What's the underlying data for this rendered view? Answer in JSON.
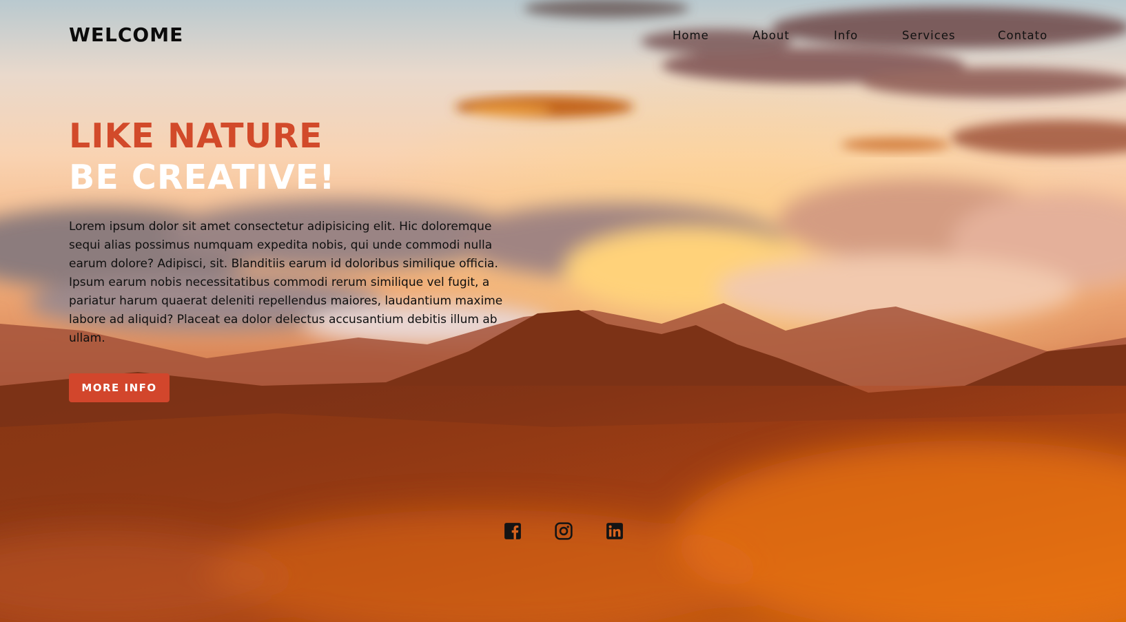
{
  "header": {
    "logo": "WELCOME",
    "nav": [
      {
        "label": "Home"
      },
      {
        "label": "About"
      },
      {
        "label": "Info"
      },
      {
        "label": "Services"
      },
      {
        "label": "Contato"
      }
    ]
  },
  "hero": {
    "title_line1": "LIKE NATURE",
    "title_line2": "BE CREATIVE!",
    "paragraph": "Lorem ipsum dolor sit amet consectetur adipisicing elit. Hic doloremque sequi alias possimus numquam expedita nobis, qui unde commodi nulla earum dolore? Adipisci, sit. Blanditiis earum id doloribus similique officia. Ipsum earum nobis necessitatibus commodi rerum similique vel fugit, a pariatur harum quaerat deleniti repellendus maiores, laudantium maxime labore ad aliquid? Placeat ea dolor delectus accusantium debitis illum ab ullam.",
    "button_label": "MORE INFO"
  },
  "social": [
    {
      "icon": "facebook-icon"
    },
    {
      "icon": "instagram-icon"
    },
    {
      "icon": "linkedin-icon"
    }
  ],
  "colors": {
    "accent": "#d2462c",
    "title_accent": "#d24a2a",
    "title_white": "#ffffff",
    "text_dark": "#0f0f0f"
  }
}
